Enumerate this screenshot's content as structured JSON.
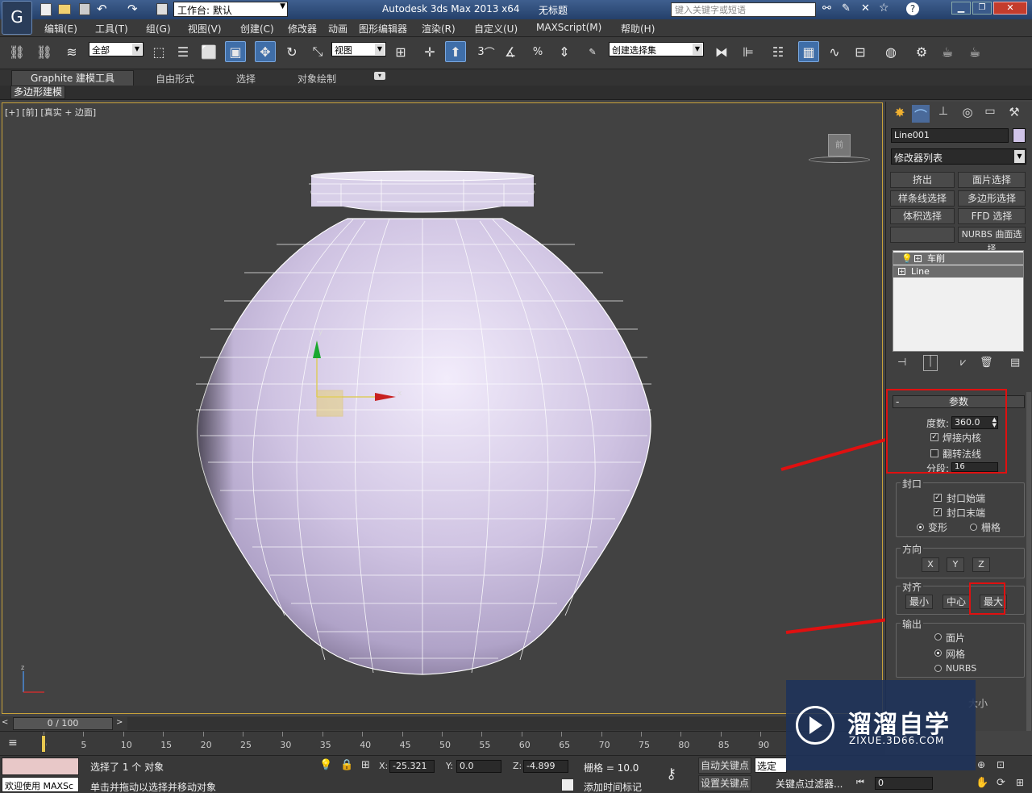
{
  "titlebar": {
    "workspace_label": "工作台: 默认",
    "app_title": "Autodesk 3ds Max  2013 x64",
    "file_title": "无标题",
    "search_placeholder": "键入关键字或短语"
  },
  "menu": [
    "编辑(E)",
    "工具(T)",
    "组(G)",
    "视图(V)",
    "创建(C)",
    "修改器",
    "动画",
    "图形编辑器",
    "渲染(R)",
    "自定义(U)",
    "MAXScript(M)",
    "帮助(H)"
  ],
  "toolbar": {
    "selection_filter": "全部",
    "ref_coord": "视图",
    "named_selection": "创建选择集",
    "snap_3": "3",
    "snap_percent": "%"
  },
  "ribbon": {
    "tabs": [
      "Graphite 建模工具",
      "自由形式",
      "选择",
      "对象绘制"
    ],
    "subtab": "多边形建模"
  },
  "viewport": {
    "label_plus": "[+]",
    "label_view": "[前]",
    "label_shading": "[真实 + 边面]",
    "viewcube_label": "前",
    "gizmo_x": "x",
    "gizmo_y": "y",
    "axis_z": "z"
  },
  "cmdpanel": {
    "object_name": "Line001",
    "modifier_list": "修改器列表",
    "mod_buttons": [
      "挤出",
      "面片选择",
      "样条线选择",
      "多边形选择",
      "体积选择",
      "FFD 选择",
      "NURBS 曲面选择"
    ],
    "stack": [
      "车削",
      "Line"
    ],
    "rollout_title": "参数",
    "degrees_label": "度数:",
    "degrees_value": "360.0",
    "weld_core": "焊接内核",
    "flip_normals": "翻转法线",
    "segments_label": "分段:",
    "segments_value": "16",
    "capping_title": "封口",
    "cap_start": "封口始端",
    "cap_end": "封口末端",
    "morph": "变形",
    "grid": "栅格",
    "direction_title": "方向",
    "dir_x": "X",
    "dir_y": "Y",
    "dir_z": "Z",
    "align_title": "对齐",
    "align_min": "最小",
    "align_center": "中心",
    "align_max": "最大",
    "output_title": "输出",
    "out_patch": "面片",
    "out_mesh": "网格",
    "out_nurbs": "NURBS",
    "partial_text": "大小"
  },
  "timeline": {
    "frame_display": "0 / 100",
    "ticks": [
      "0",
      "5",
      "10",
      "15",
      "20",
      "25",
      "30",
      "35",
      "40",
      "45",
      "50",
      "55",
      "60",
      "65",
      "70",
      "75",
      "80",
      "85",
      "90"
    ]
  },
  "status": {
    "maxscript_label": "欢迎使用 MAXSc",
    "selected_text": "选择了 1 个 对象",
    "prompt_text": "单击并拖动以选择并移动对象",
    "x_label": "X:",
    "x_value": "-25.321",
    "y_label": "Y:",
    "y_value": "0.0",
    "z_label": "Z:",
    "z_value": "-4.899",
    "grid_text": "栅格 = 10.0",
    "auto_key": "自动关键点",
    "set_key": "设置关键点",
    "selected_obj": "选定对",
    "key_filters": "关键点过滤器...",
    "add_time_tag": "添加时间标记",
    "frame_value": "0"
  },
  "watermark": {
    "title": "溜溜自学",
    "url": "ZIXUE.3D66.COM"
  },
  "colors": {
    "vase_fill": "#d8cfe8",
    "annotation_red": "#e01010",
    "active_blue": "#3f6ea8"
  }
}
